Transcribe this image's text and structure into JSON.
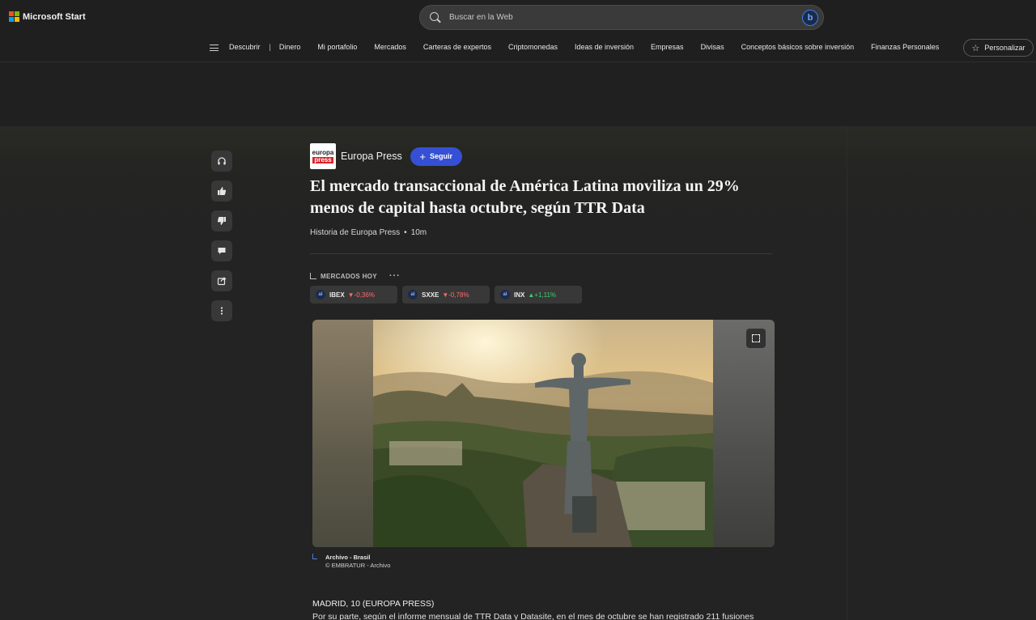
{
  "brand": {
    "name": "Microsoft Start"
  },
  "search": {
    "placeholder": "Buscar en la Web"
  },
  "nav": {
    "items": [
      "Descubrir",
      "Dinero",
      "Mi portafolio",
      "Mercados",
      "Carteras de expertos",
      "Criptomonedas",
      "Ideas de inversión",
      "Empresas",
      "Divisas",
      "Conceptos básicos sobre inversión",
      "Finanzas Personales"
    ],
    "separator": "|",
    "personalize_label": "Personalizar"
  },
  "article": {
    "publisher": "Europa Press",
    "publisher_logo": {
      "line1": "europa",
      "line2": "press"
    },
    "follow_label": "Seguir",
    "headline": "El mercado transaccional de América Latina moviliza un 29% menos de capital hasta octubre, según TTR Data",
    "byline": "Historia de Europa Press",
    "time_ago": "10m",
    "markets_label": "MERCADOS HOY",
    "tickers": [
      {
        "symbol": "IBEX",
        "change": "-0,36%",
        "direction": "down"
      },
      {
        "symbol": "SXXE",
        "change": "-0,78%",
        "direction": "down"
      },
      {
        "symbol": "INX",
        "change": "+1,11%",
        "direction": "up"
      }
    ],
    "image_caption_title": "Archivo - Brasil",
    "image_caption_credit": "© EMBRATUR - Archivo",
    "dateline": "MADRID, 10 (EUROPA PRESS)",
    "body_first_line": "Por su parte, según el informe mensual de TTR Data y Datasite, en el mes de octubre se han registrado 211 fusiones"
  },
  "actions": [
    "headphones-icon",
    "thumbs-up-icon",
    "thumbs-down-icon",
    "comment-icon",
    "share-icon",
    "more-vertical-icon"
  ],
  "colors": {
    "accent": "#3550d4",
    "down": "#ff6b6b",
    "up": "#3fcf6a",
    "background": "#1f1f1f"
  }
}
